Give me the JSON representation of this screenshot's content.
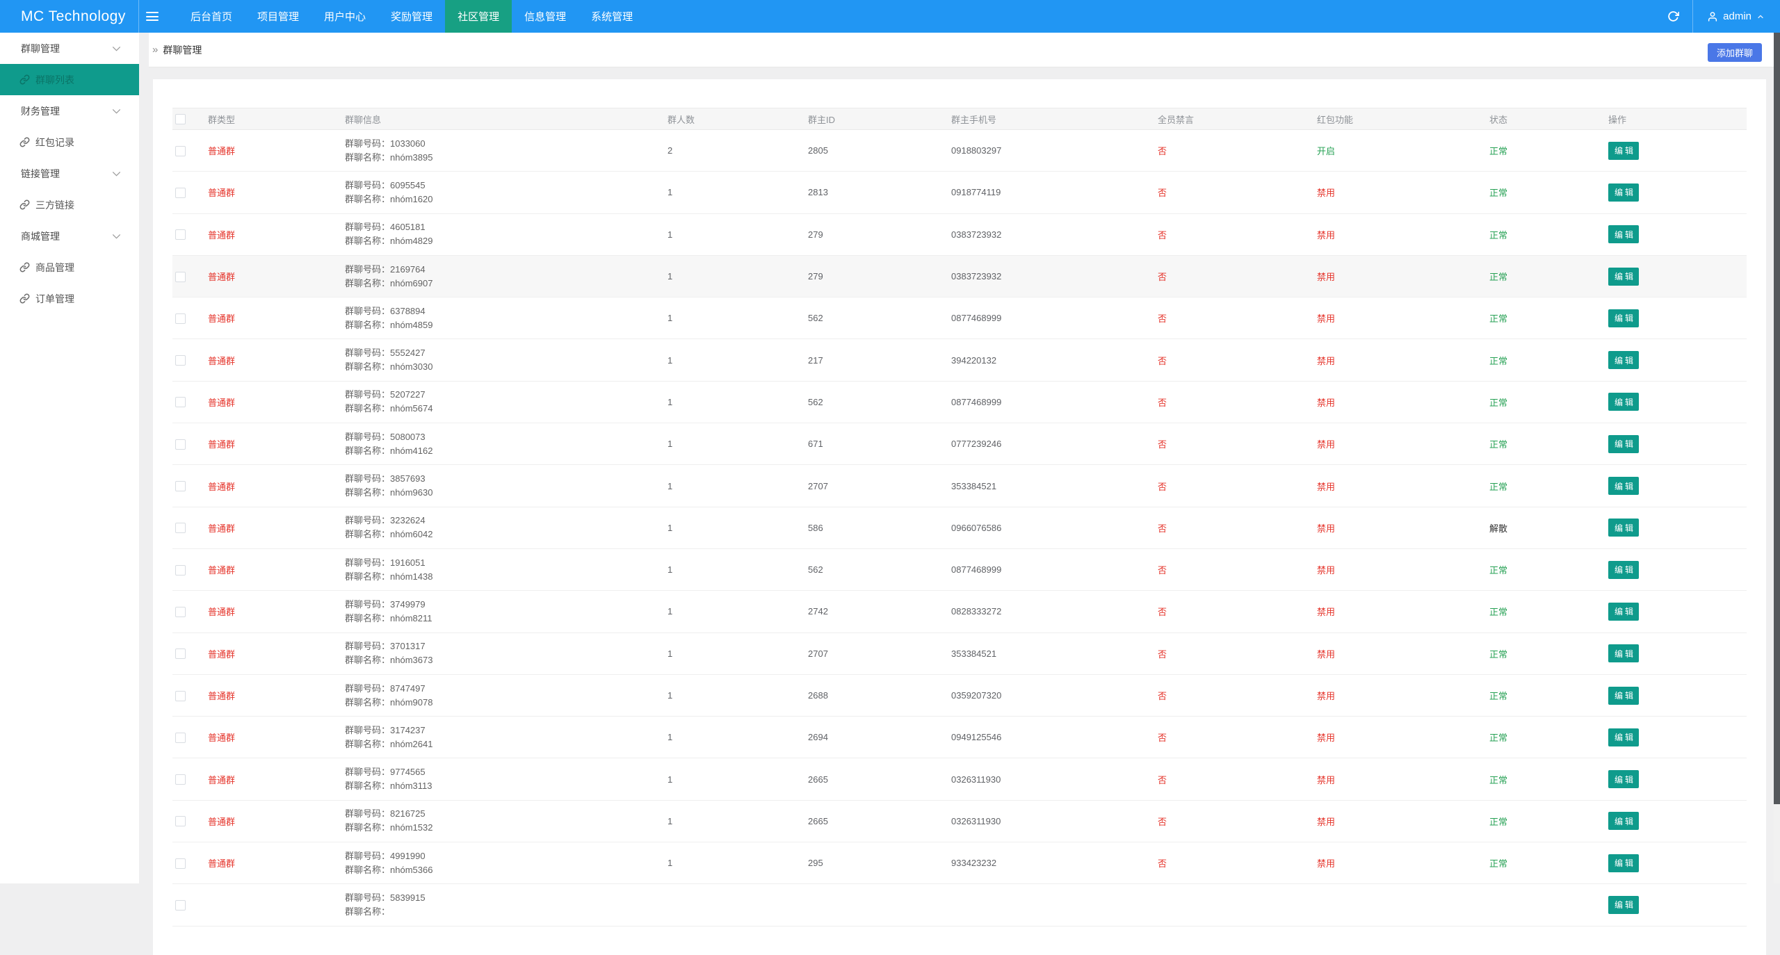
{
  "navbar": {
    "brand": "MC Technology",
    "items": [
      {
        "label": "后台首页",
        "active": false
      },
      {
        "label": "项目管理",
        "active": false
      },
      {
        "label": "用户中心",
        "active": false
      },
      {
        "label": "奖励管理",
        "active": false
      },
      {
        "label": "社区管理",
        "active": true
      },
      {
        "label": "信息管理",
        "active": false
      },
      {
        "label": "系统管理",
        "active": false
      }
    ],
    "username": "admin"
  },
  "icons": {
    "hamburger": "menu-bars",
    "refresh": "circular-arrow",
    "user": "person-silhouette",
    "caret": "chevron-up",
    "group_collapse": "chevron-down",
    "menu_link": "chain-link"
  },
  "sidebar": {
    "items": [
      {
        "label": "群聊管理",
        "type": "group"
      },
      {
        "label": "群聊列表",
        "type": "link",
        "active": true
      },
      {
        "label": "财务管理",
        "type": "group"
      },
      {
        "label": "红包记录",
        "type": "link"
      },
      {
        "label": "链接管理",
        "type": "group"
      },
      {
        "label": "三方链接",
        "type": "link"
      },
      {
        "label": "商城管理",
        "type": "group"
      },
      {
        "label": "商品管理",
        "type": "link"
      },
      {
        "label": "订单管理",
        "type": "link"
      }
    ]
  },
  "breadcrumb": {
    "arrow": "»",
    "title": "群聊管理"
  },
  "toolbar": {
    "add_label": "添加群聊"
  },
  "table": {
    "columns": [
      "群类型",
      "群聊信息",
      "群人数",
      "群主ID",
      "群主手机号",
      "全员禁言",
      "红包功能",
      "状态",
      "操作"
    ],
    "labels": {
      "group_no": "群聊号码：",
      "group_name": "群聊名称："
    },
    "edit_label": "编辑",
    "rows": [
      {
        "type": "普通群",
        "no": "1033060",
        "name": "nhóm3895",
        "members": "2",
        "owner_id": "2805",
        "phone": "0918803297",
        "mute": "否",
        "redpacket": "开启",
        "status": "正常"
      },
      {
        "type": "普通群",
        "no": "6095545",
        "name": "nhóm1620",
        "members": "1",
        "owner_id": "2813",
        "phone": "0918774119",
        "mute": "否",
        "redpacket": "禁用",
        "status": "正常"
      },
      {
        "type": "普通群",
        "no": "4605181",
        "name": "nhóm4829",
        "members": "1",
        "owner_id": "279",
        "phone": "0383723932",
        "mute": "否",
        "redpacket": "禁用",
        "status": "正常"
      },
      {
        "type": "普通群",
        "no": "2169764",
        "name": "nhóm6907",
        "members": "1",
        "owner_id": "279",
        "phone": "0383723932",
        "mute": "否",
        "redpacket": "禁用",
        "status": "正常",
        "highlight": true
      },
      {
        "type": "普通群",
        "no": "6378894",
        "name": "nhóm4859",
        "members": "1",
        "owner_id": "562",
        "phone": "0877468999",
        "mute": "否",
        "redpacket": "禁用",
        "status": "正常"
      },
      {
        "type": "普通群",
        "no": "5552427",
        "name": "nhóm3030",
        "members": "1",
        "owner_id": "217",
        "phone": "394220132",
        "mute": "否",
        "redpacket": "禁用",
        "status": "正常"
      },
      {
        "type": "普通群",
        "no": "5207227",
        "name": "nhóm5674",
        "members": "1",
        "owner_id": "562",
        "phone": "0877468999",
        "mute": "否",
        "redpacket": "禁用",
        "status": "正常"
      },
      {
        "type": "普通群",
        "no": "5080073",
        "name": "nhóm4162",
        "members": "1",
        "owner_id": "671",
        "phone": "0777239246",
        "mute": "否",
        "redpacket": "禁用",
        "status": "正常"
      },
      {
        "type": "普通群",
        "no": "3857693",
        "name": "nhóm9630",
        "members": "1",
        "owner_id": "2707",
        "phone": "353384521",
        "mute": "否",
        "redpacket": "禁用",
        "status": "正常"
      },
      {
        "type": "普通群",
        "no": "3232624",
        "name": "nhóm6042",
        "members": "1",
        "owner_id": "586",
        "phone": "0966076586",
        "mute": "否",
        "redpacket": "禁用",
        "status": "解散"
      },
      {
        "type": "普通群",
        "no": "1916051",
        "name": "nhóm1438",
        "members": "1",
        "owner_id": "562",
        "phone": "0877468999",
        "mute": "否",
        "redpacket": "禁用",
        "status": "正常"
      },
      {
        "type": "普通群",
        "no": "3749979",
        "name": "nhóm8211",
        "members": "1",
        "owner_id": "2742",
        "phone": "0828333272",
        "mute": "否",
        "redpacket": "禁用",
        "status": "正常"
      },
      {
        "type": "普通群",
        "no": "3701317",
        "name": "nhóm3673",
        "members": "1",
        "owner_id": "2707",
        "phone": "353384521",
        "mute": "否",
        "redpacket": "禁用",
        "status": "正常"
      },
      {
        "type": "普通群",
        "no": "8747497",
        "name": "nhóm9078",
        "members": "1",
        "owner_id": "2688",
        "phone": "0359207320",
        "mute": "否",
        "redpacket": "禁用",
        "status": "正常"
      },
      {
        "type": "普通群",
        "no": "3174237",
        "name": "nhóm2641",
        "members": "1",
        "owner_id": "2694",
        "phone": "0949125546",
        "mute": "否",
        "redpacket": "禁用",
        "status": "正常"
      },
      {
        "type": "普通群",
        "no": "9774565",
        "name": "nhóm3113",
        "members": "1",
        "owner_id": "2665",
        "phone": "0326311930",
        "mute": "否",
        "redpacket": "禁用",
        "status": "正常"
      },
      {
        "type": "普通群",
        "no": "8216725",
        "name": "nhóm1532",
        "members": "1",
        "owner_id": "2665",
        "phone": "0326311930",
        "mute": "否",
        "redpacket": "禁用",
        "status": "正常"
      },
      {
        "type": "普通群",
        "no": "4991990",
        "name": "nhóm5366",
        "members": "1",
        "owner_id": "295",
        "phone": "933423232",
        "mute": "否",
        "redpacket": "禁用",
        "status": "正常"
      },
      {
        "no": "5839915"
      }
    ]
  },
  "colors": {
    "navbar_blue": "#2196f3",
    "nav_active_teal": "#17a083",
    "sidebar_active_teal": "#0f9b8c",
    "button_teal": "#0f9b8c",
    "add_button_blue": "#4a77e7",
    "danger_red": "#e5342b",
    "success_green": "#26a154"
  }
}
